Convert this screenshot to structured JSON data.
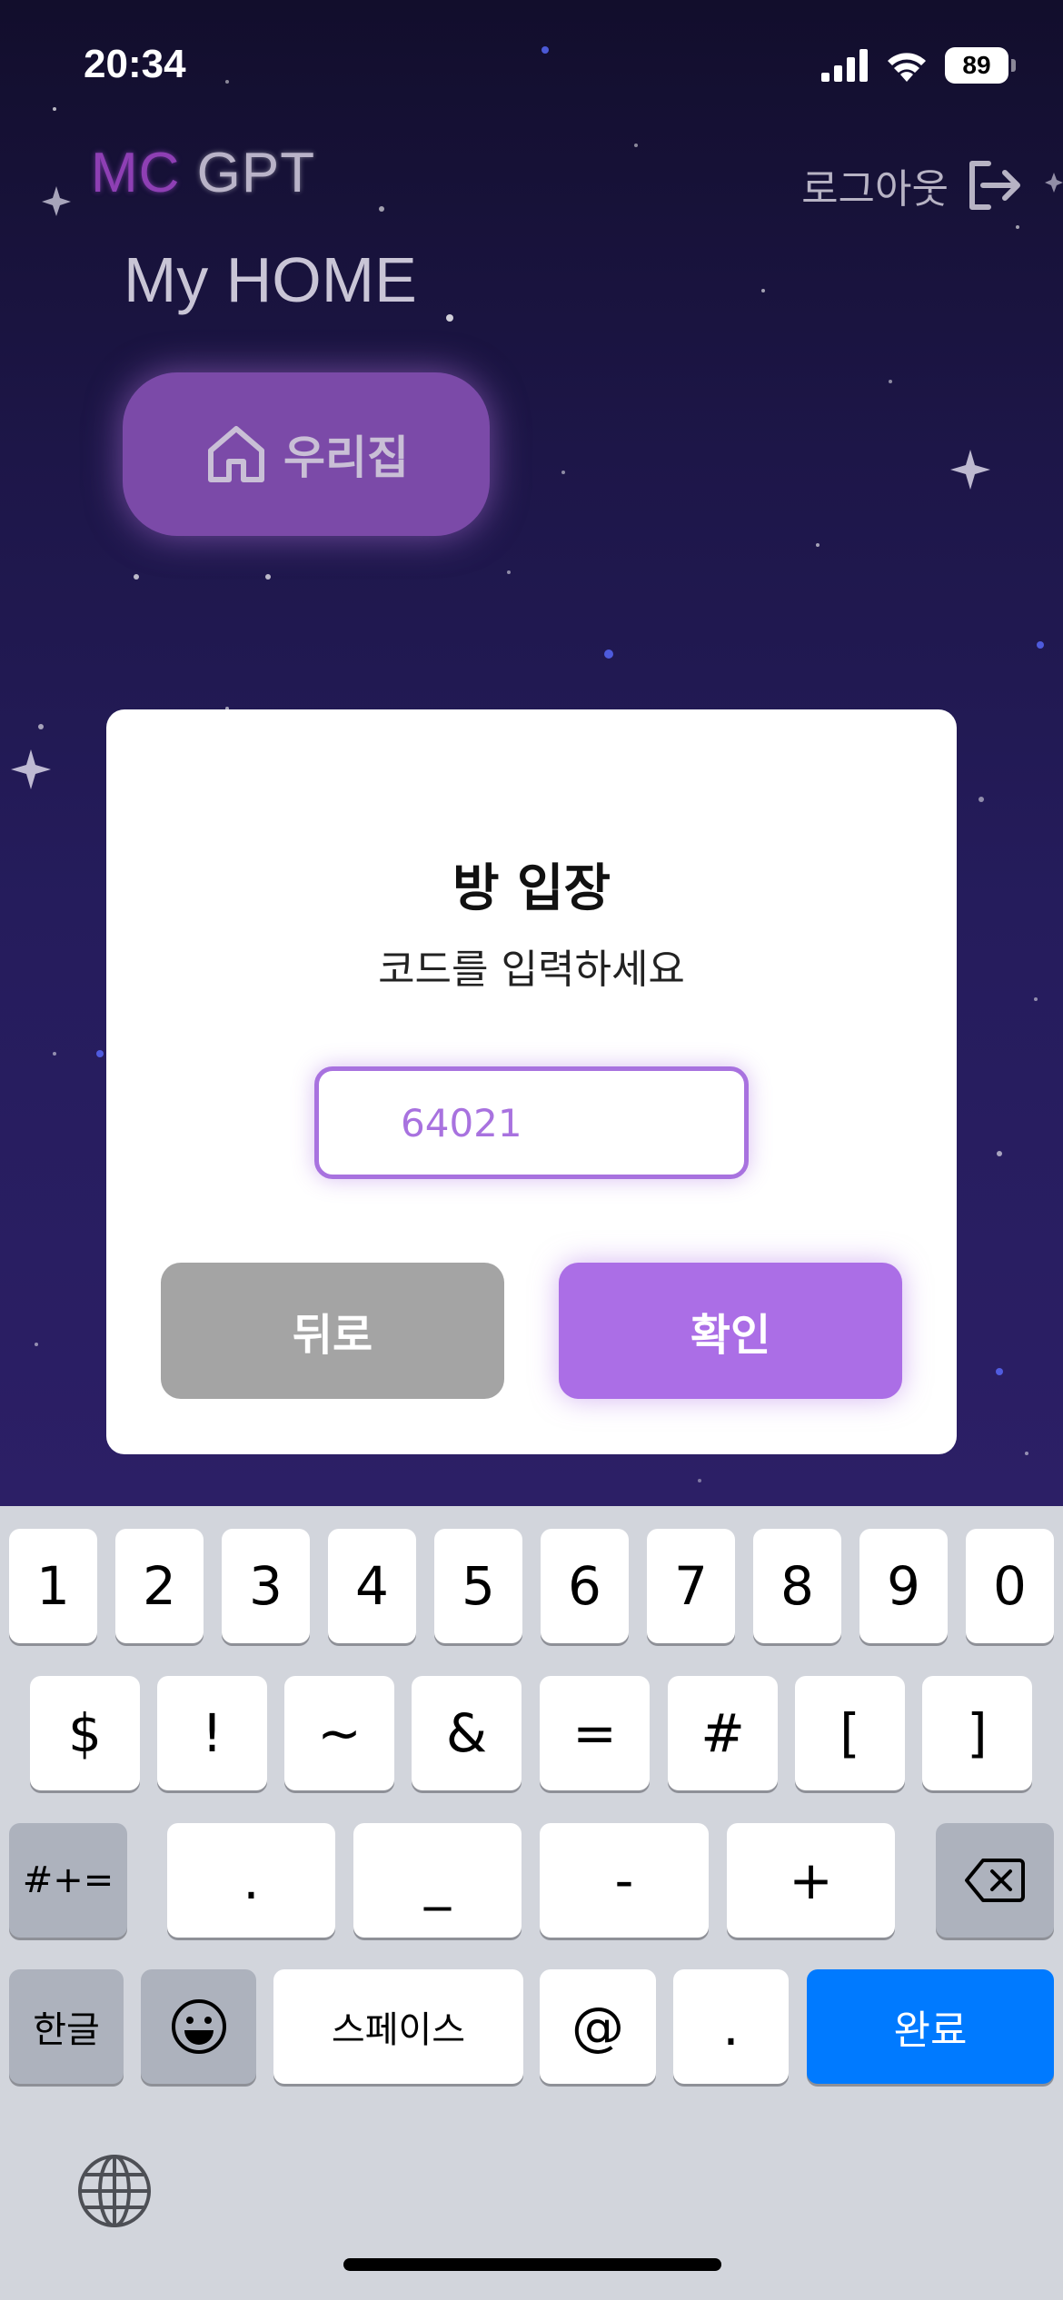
{
  "status_bar": {
    "time": "20:34",
    "battery": "89"
  },
  "header": {
    "logo_mc": "MC",
    "logo_gpt": "GPT",
    "logout_label": "로그아웃"
  },
  "page": {
    "title": "My HOME",
    "home_button_label": "우리집"
  },
  "modal": {
    "title": "방 입장",
    "subtitle": "코드를 입력하세요",
    "code_value": "64021",
    "back_label": "뒤로",
    "confirm_label": "확인"
  },
  "keyboard": {
    "row1": [
      "1",
      "2",
      "3",
      "4",
      "5",
      "6",
      "7",
      "8",
      "9",
      "0"
    ],
    "row2": [
      "$",
      "!",
      "~",
      "&",
      "=",
      "#",
      "[",
      "]"
    ],
    "row3_more": "#+=",
    "row3": [
      ".",
      "_",
      "-",
      "+"
    ],
    "row4_lang": "한글",
    "row4_space": "스페이스",
    "row4_at": "@",
    "row4_dot": ".",
    "row4_done": "완료"
  },
  "colors": {
    "accent": "#ab6ee6",
    "done_key": "#007aff"
  }
}
